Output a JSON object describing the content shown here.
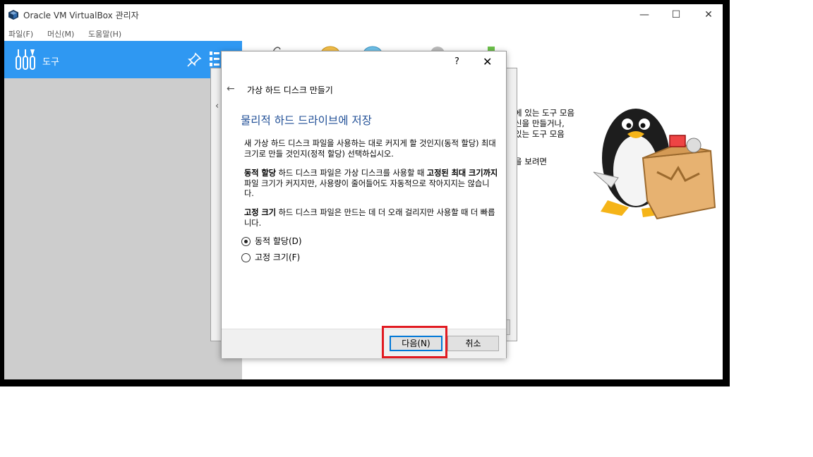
{
  "window": {
    "title": "Oracle VM VirtualBox 관리자",
    "minimize": "—",
    "maximize": "☐",
    "close": "✕"
  },
  "menu": {
    "items": [
      "파일(F)",
      "머신(M)",
      "도움말(H)"
    ]
  },
  "sidebar": {
    "tools_label": "도구",
    "accent": "#2f98f2"
  },
  "welcome": {
    "lines": [
      "에 있는 도구 모음",
      "신을 만들거나,",
      "있는 도구 모음",
      "을 보려면"
    ]
  },
  "dialog": {
    "help": "?",
    "close": "✕",
    "back_icon": "←",
    "title": "가상 하드 디스크 만들기",
    "heading": "물리적 하드 드라이브에 저장",
    "para1": "새 가상 하드 디스크 파일을 사용하는 대로 커지게 할 것인지(동적 할당) 최대 크기로 만들 것인지(정적 할당) 선택하십시오.",
    "para2_bold1": "동적 할당",
    "para2_text1": " 하드 디스크 파일은 가상 디스크를 사용할 때 ",
    "para2_bold2": "고정된 최대 크기까지",
    "para2_text2": " 파일 크기가 커지지만, 사용량이 줄어들어도 자동적으로 작아지지는 않습니다.",
    "para3_bold": "고정 크기",
    "para3_text": " 하드 디스크 파일은 만드는 데 더 오래 걸리지만 사용할 때 더 빠릅니다.",
    "option_dynamic": "동적 할당(D)",
    "option_fixed": "고정 크기(F)",
    "selected": "동적 할당(D)",
    "next_button": "다음(N)",
    "cancel_button": "취소",
    "highlight_color": "#e11b22"
  }
}
